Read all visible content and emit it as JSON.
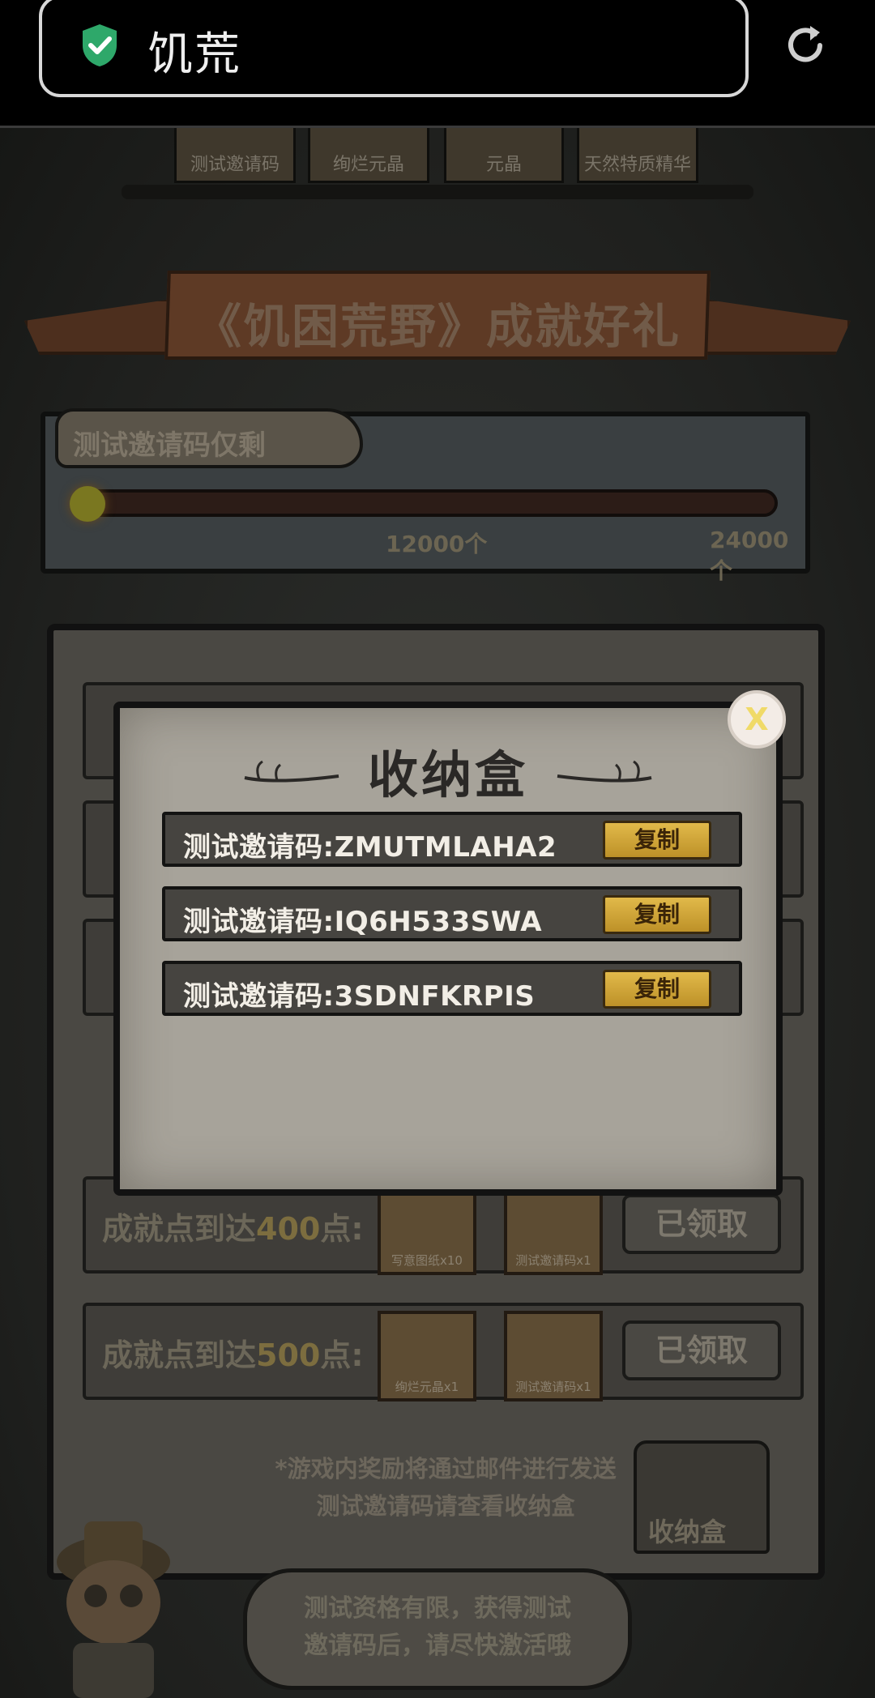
{
  "browser": {
    "title": "饥荒"
  },
  "top_tabs": [
    "测试邀请码",
    "绚烂元晶",
    "元晶",
    "天然特质精华"
  ],
  "banner": {
    "title": "《饥困荒野》成就好礼"
  },
  "progress": {
    "label": "测试邀请码仅剩",
    "fraction": 0.02,
    "markers": [
      "12000个",
      "24000个"
    ]
  },
  "rows": [
    {
      "prefix": "成就点到达",
      "points": "400",
      "suffix": "点:",
      "rewards": [
        "写意图纸x10",
        "测试邀请码x1"
      ],
      "status": "已领取"
    },
    {
      "prefix": "成就点到达",
      "points": "500",
      "suffix": "点:",
      "rewards": [
        "绚烂元晶x1",
        "测试邀请码x1"
      ],
      "status": "已领取"
    }
  ],
  "notice": {
    "line1": "*游戏内奖励将通过邮件进行发送",
    "line2": "测试邀请码请查看收纳盒"
  },
  "storage_box_label": "收纳盒",
  "bubble": {
    "line1": "测试资格有限，获得测试",
    "line2": "邀请码后，请尽快激活哦"
  },
  "modal": {
    "title": "收纳盒",
    "close_label": "X",
    "codes": [
      {
        "text": "测试邀请码:ZMUTMLAHA2",
        "button": "复制"
      },
      {
        "text": "测试邀请码:IQ6H533SWA",
        "button": "复制"
      },
      {
        "text": "测试邀请码:3SDNFKRPIS",
        "button": "复制"
      }
    ]
  },
  "colors": {
    "copy_button": "#d4a93a",
    "modal_paper": "#a7a39a",
    "secure_shield": "#2ea86a"
  }
}
